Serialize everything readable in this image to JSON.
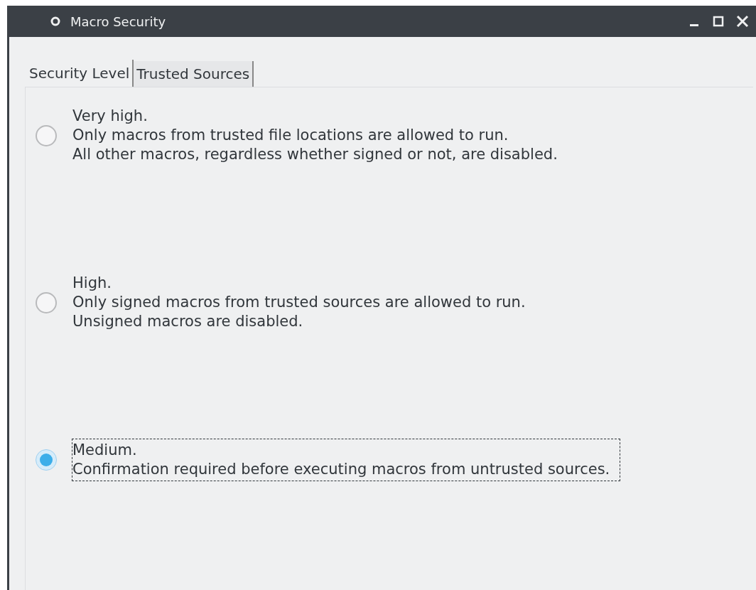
{
  "window": {
    "title": "Macro Security"
  },
  "tabs": [
    {
      "label": "Security Level",
      "selected": true
    },
    {
      "label": "Trusted Sources",
      "selected": false
    }
  ],
  "options": [
    {
      "title": "Very high.",
      "lines": [
        "Only macros from trusted file locations are allowed to run.",
        "All other macros, regardless whether signed or not, are disabled."
      ],
      "selected": false,
      "focused": false
    },
    {
      "title": "High.",
      "lines": [
        "Only signed macros from trusted sources are allowed to run.",
        "Unsigned macros are disabled."
      ],
      "selected": false,
      "focused": false
    },
    {
      "title": "Medium.",
      "lines": [
        "Confirmation required before executing macros from untrusted sources."
      ],
      "selected": true,
      "focused": true
    }
  ]
}
